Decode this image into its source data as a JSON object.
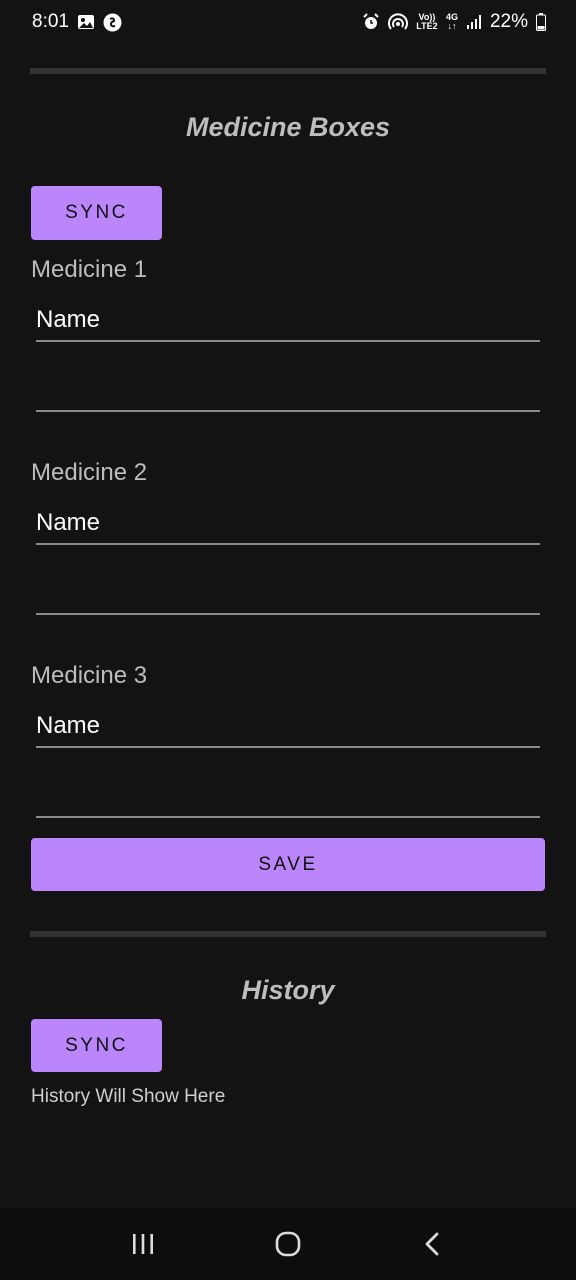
{
  "status_bar": {
    "time": "8:01",
    "battery_percent": "22%",
    "network_4g": "4G",
    "network_volte": "Vo)) LTE2",
    "icons": [
      "image-icon",
      "shazam-icon",
      "alarm-icon",
      "hotspot-icon",
      "volte-icon",
      "4g-icon",
      "signal-icon",
      "battery-icon"
    ]
  },
  "medicine_section": {
    "title": "Medicine Boxes",
    "sync_label": "SYNC",
    "save_label": "SAVE",
    "medicines": [
      {
        "label": "Medicine 1",
        "name_placeholder": "Name",
        "second_value": ""
      },
      {
        "label": "Medicine 2",
        "name_placeholder": "Name",
        "second_value": ""
      },
      {
        "label": "Medicine 3",
        "name_placeholder": "Name",
        "second_value": ""
      }
    ]
  },
  "history_section": {
    "title": "History",
    "sync_label": "SYNC",
    "placeholder_text": "History Will Show Here"
  },
  "nav_bar": {
    "icons": [
      "recents-icon",
      "home-icon",
      "back-icon"
    ]
  },
  "colors": {
    "background": "#131313",
    "accent": "#bb86fc",
    "divider": "#323232"
  }
}
